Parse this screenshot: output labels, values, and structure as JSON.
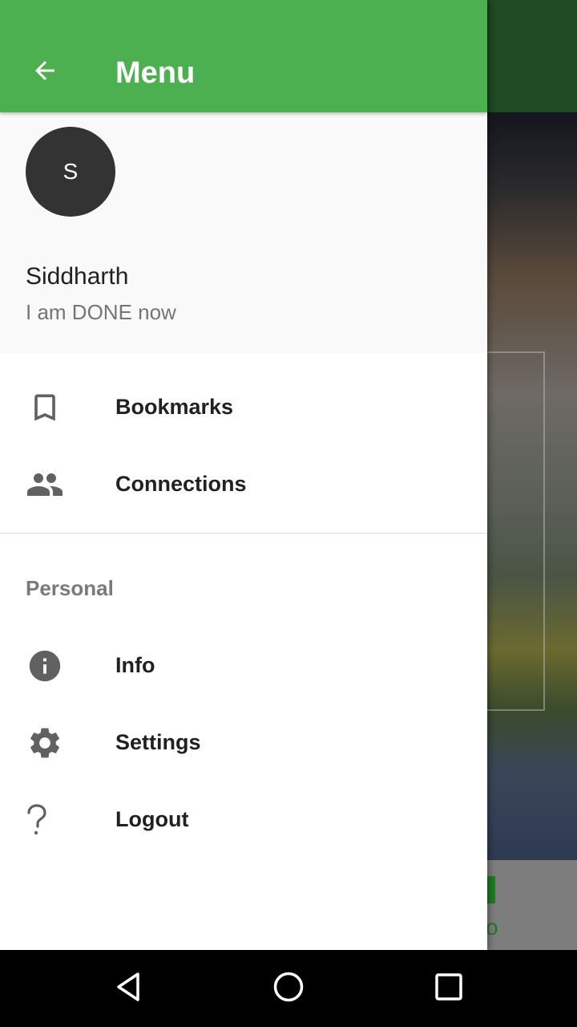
{
  "app": {
    "toolbar_title": "Menu",
    "background_tab_label": "o"
  },
  "profile": {
    "avatar_initial": "S",
    "name": "Siddharth",
    "status": "I am DONE now"
  },
  "menu": {
    "items": [
      {
        "label": "Bookmarks",
        "icon": "bookmark-icon"
      },
      {
        "label": "Connections",
        "icon": "people-icon"
      }
    ],
    "section_title": "Personal",
    "personal_items": [
      {
        "label": "Info",
        "icon": "info-icon"
      },
      {
        "label": "Settings",
        "icon": "gear-icon"
      },
      {
        "label": "Logout",
        "icon": "question-mark-icon"
      }
    ]
  },
  "colors": {
    "toolbar": "#4caf50",
    "icon_gray": "#616161"
  },
  "navbar": {
    "buttons": [
      "back-nav-icon",
      "home-nav-icon",
      "recents-nav-icon"
    ]
  }
}
